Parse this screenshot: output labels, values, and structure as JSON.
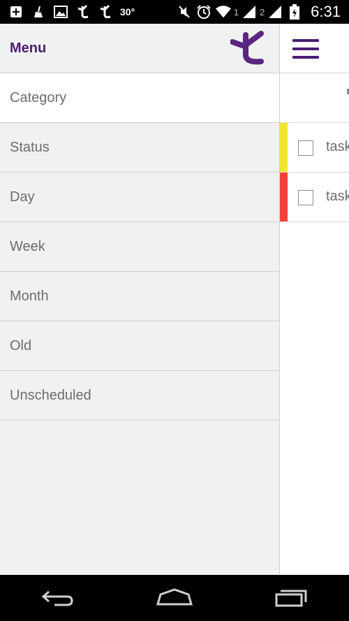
{
  "status_bar": {
    "temperature": "30°",
    "sim1": "1",
    "sim2": "2",
    "time": "6:31",
    "icons": [
      "plus-icon",
      "broom-icon",
      "image-icon",
      "app-t-icon",
      "app-t-icon",
      "mute-icon",
      "alarm-icon",
      "wifi-icon",
      "signal-icon",
      "signal-icon",
      "battery-charging-icon"
    ]
  },
  "drawer": {
    "title": "Menu",
    "logo": "app-logo",
    "items": [
      {
        "label": "Category",
        "active": true
      },
      {
        "label": "Status"
      },
      {
        "label": "Day"
      },
      {
        "label": "Week"
      },
      {
        "label": "Month"
      },
      {
        "label": "Old"
      },
      {
        "label": "Unscheduled"
      }
    ]
  },
  "main": {
    "menu_icon": "hamburger-icon",
    "tasks": [
      {
        "label": "task",
        "color": "#f2e42c"
      },
      {
        "label": "task",
        "color": "#f2403a"
      }
    ]
  },
  "navigation": {
    "buttons": [
      "back-icon",
      "home-icon",
      "recents-icon"
    ]
  },
  "colors": {
    "accent": "#4b1d73",
    "drawer_bg": "#f0f1f1"
  }
}
